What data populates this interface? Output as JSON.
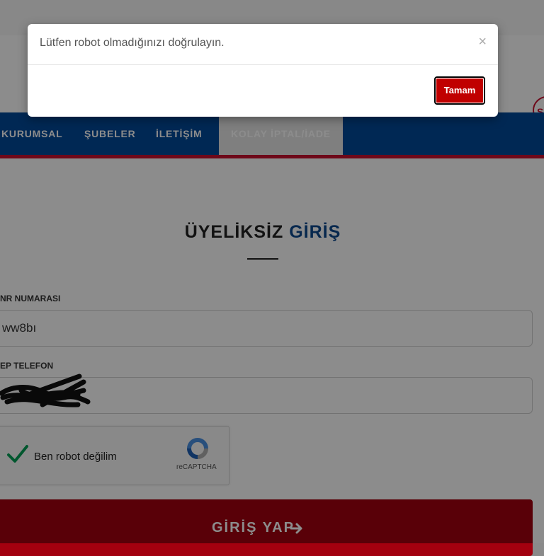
{
  "modal": {
    "message": "Lütfen robot olmadığınızı doğrulayın.",
    "close_glyph": "×",
    "ok_label": "Tamam"
  },
  "header": {
    "logo_glyph": "S"
  },
  "nav": {
    "items": [
      {
        "label": "KURUMSAL"
      },
      {
        "label": "ŞUBELER"
      },
      {
        "label": "İLETİŞİM"
      },
      {
        "label": "KOLAY İPTAL/İADE"
      }
    ]
  },
  "form": {
    "title_part1": "ÜYELİKSİZ",
    "title_part2": "GİRİŞ",
    "pnr_label": "NR NUMARASI",
    "pnr_value": "ww8bı",
    "phone_label": "EP TELEFON",
    "captcha_text": "Ben robot değilim",
    "captcha_brand": "reCAPTCHA",
    "submit_label": "GİRİŞ YAP"
  },
  "colors": {
    "nav_blue": "#004a99",
    "accent_red": "#c8102e",
    "submit_red": "#a3000f",
    "title_blue": "#0d4a8f",
    "check_green": "#009e55"
  },
  "icons": [
    "close-icon",
    "checkmark-icon",
    "recaptcha-logo-icon",
    "arrow-right-icon"
  ]
}
